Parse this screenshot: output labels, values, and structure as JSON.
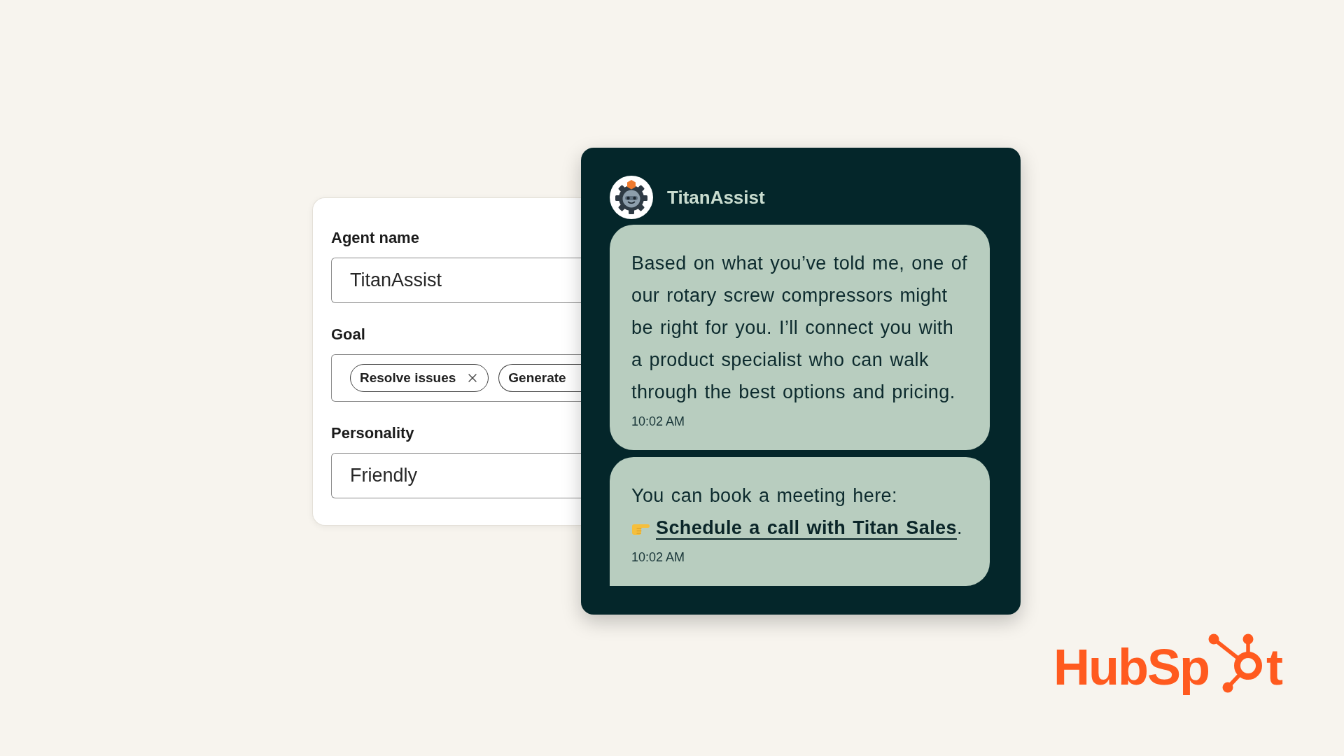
{
  "config_card": {
    "fields": [
      {
        "kind": "text",
        "label": "Agent name",
        "value": "TitanAssist"
      },
      {
        "kind": "tags",
        "label": "Goal",
        "tags": [
          {
            "label": "Resolve issues",
            "removable": true
          },
          {
            "label": "Generate",
            "removable": false
          }
        ]
      },
      {
        "kind": "text",
        "label": "Personality",
        "value": "Friendly"
      }
    ]
  },
  "chat": {
    "agent_name": "TitanAssist",
    "messages": [
      {
        "kind": "text",
        "text": "Based on what you’ve told me, one of our rotary screw compressors might be right for you. I’ll connect you with a product specialist who can walk through the best options and pricing.",
        "time": "10:02 AM"
      },
      {
        "kind": "link",
        "text": "You can book a meeting here:",
        "link": "Schedule a call with Titan Sales",
        "after_link": ".",
        "time": "10:02 AM"
      }
    ]
  },
  "logo": {
    "before_mark": "HubSp",
    "after_mark": "t"
  }
}
